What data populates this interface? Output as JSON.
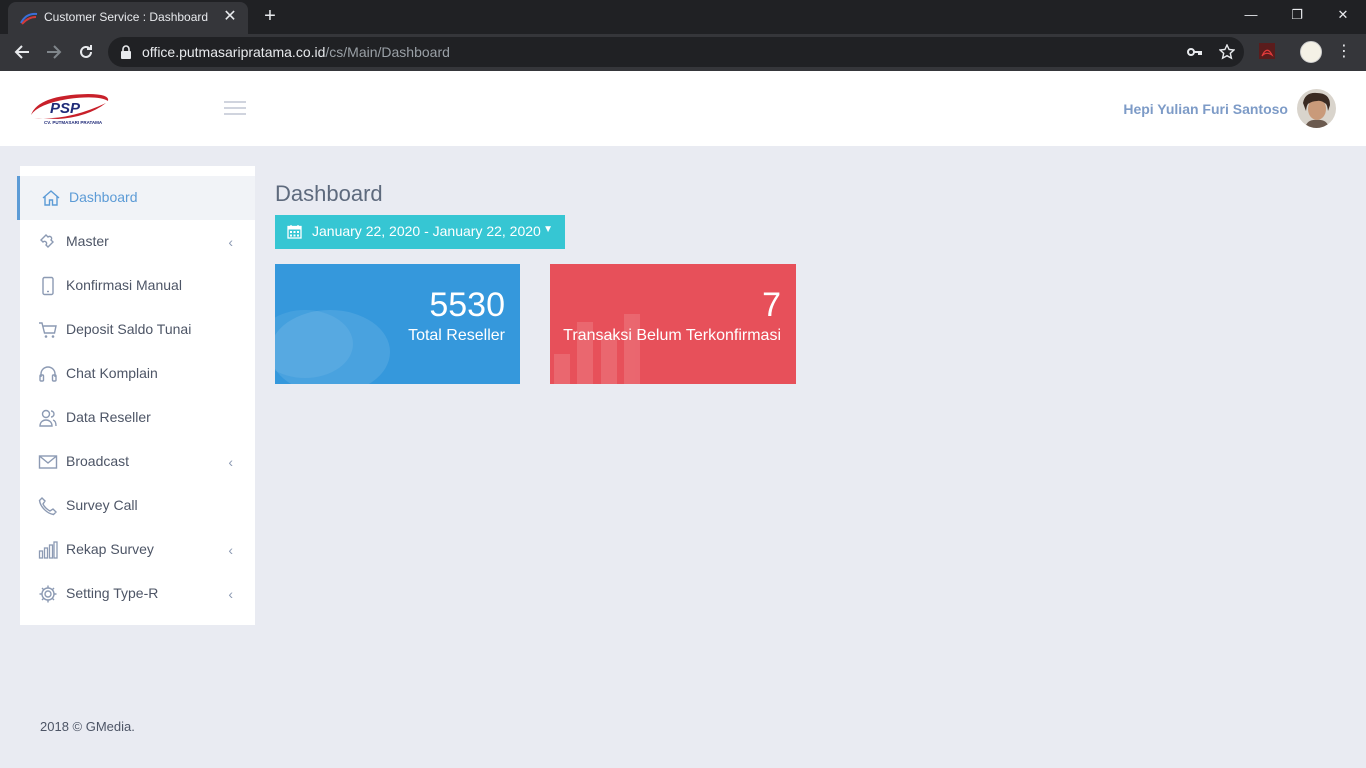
{
  "browser": {
    "tab_title": "Customer Service : Dashboard",
    "url_domain": "office.putmasaripratama.co.id",
    "url_path": "/cs/Main/Dashboard"
  },
  "header": {
    "user_name": "Hepi Yulian Furi Santoso"
  },
  "logo": {
    "text": "PSP",
    "subtext": "CV. PUTMASARI PRATAMA"
  },
  "sidebar": {
    "items": [
      {
        "label": "Dashboard",
        "icon": "home-icon",
        "active": true,
        "has_submenu": false
      },
      {
        "label": "Master",
        "icon": "puzzle-icon",
        "active": false,
        "has_submenu": true
      },
      {
        "label": "Konfirmasi Manual",
        "icon": "phone-icon",
        "active": false,
        "has_submenu": false
      },
      {
        "label": "Deposit Saldo Tunai",
        "icon": "cart-icon",
        "active": false,
        "has_submenu": false
      },
      {
        "label": "Chat Komplain",
        "icon": "headset-icon",
        "active": false,
        "has_submenu": false
      },
      {
        "label": "Data Reseller",
        "icon": "users-icon",
        "active": false,
        "has_submenu": false
      },
      {
        "label": "Broadcast",
        "icon": "envelope-icon",
        "active": false,
        "has_submenu": true
      },
      {
        "label": "Survey Call",
        "icon": "call-icon",
        "active": false,
        "has_submenu": false
      },
      {
        "label": "Rekap Survey",
        "icon": "bar-chart-icon",
        "active": false,
        "has_submenu": true
      },
      {
        "label": "Setting Type-R",
        "icon": "gear-icon",
        "active": false,
        "has_submenu": true
      }
    ]
  },
  "main": {
    "title": "Dashboard",
    "date_range": "January 22, 2020 - January 22, 2020",
    "stats": [
      {
        "number": "5530",
        "desc": "Total Reseller",
        "color": "#3598dc"
      },
      {
        "number": "7",
        "desc": "Transaksi Belum Terkonfirmasi",
        "color": "#e7505a"
      }
    ]
  },
  "footer": {
    "text": "2018 © GMedia."
  },
  "colors": {
    "accent": "#5c9bd6",
    "date_button": "#36c6d3"
  }
}
